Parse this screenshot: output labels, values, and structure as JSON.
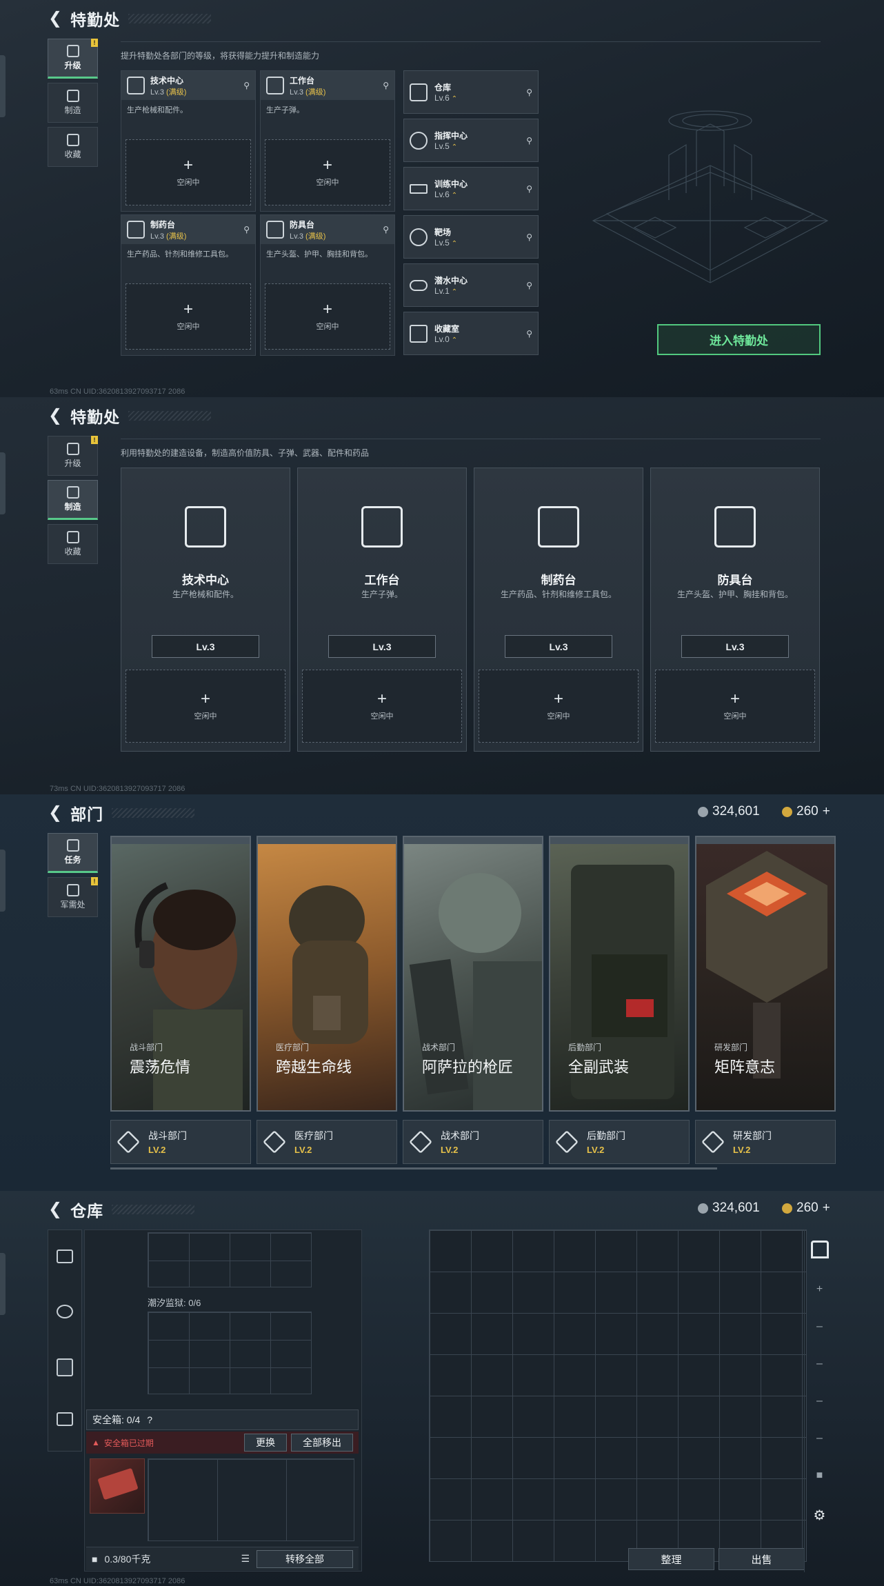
{
  "panel1": {
    "title": "特勤处",
    "description": "提升特勤处各部门的等级，将获得能力提升和制造能力",
    "tabs": [
      {
        "label": "升级",
        "badge": "!"
      },
      {
        "label": "制造"
      },
      {
        "label": "收藏"
      }
    ],
    "workshops": [
      {
        "name": "技术中心",
        "level": "Lv.3",
        "maxed": "(满级)",
        "desc": "生产枪械和配件。",
        "slot": "空闲中"
      },
      {
        "name": "工作台",
        "level": "Lv.3",
        "maxed": "(满级)",
        "desc": "生产子弹。",
        "slot": "空闲中"
      },
      {
        "name": "制药台",
        "level": "Lv.3",
        "maxed": "(满级)",
        "desc": "生产药品、针剂和维修工具包。",
        "slot": "空闲中"
      },
      {
        "name": "防具台",
        "level": "Lv.3",
        "maxed": "(满级)",
        "desc": "生产头盔、护甲、胸挂和背包。",
        "slot": "空闲中"
      }
    ],
    "rooms": [
      {
        "name": "仓库",
        "level": "Lv.6"
      },
      {
        "name": "指挥中心",
        "level": "Lv.5"
      },
      {
        "name": "训练中心",
        "level": "Lv.6"
      },
      {
        "name": "靶场",
        "level": "Lv.5"
      },
      {
        "name": "潜水中心",
        "level": "Lv.1"
      },
      {
        "name": "收藏室",
        "level": "Lv.0"
      }
    ],
    "enter_button": "进入特勤处",
    "status": "63ms   CN UID:3620813927093717 2086"
  },
  "panel2": {
    "title": "特勤处",
    "description": "利用特勤处的建造设备，制造高价值防具、子弹、武器、配件和药品",
    "tabs": [
      {
        "label": "升级",
        "badge": "!"
      },
      {
        "label": "制造"
      },
      {
        "label": "收藏"
      }
    ],
    "cards": [
      {
        "name": "技术中心",
        "desc": "生产枪械和配件。",
        "level": "Lv.3",
        "slot": "空闲中"
      },
      {
        "name": "工作台",
        "desc": "生产子弹。",
        "level": "Lv.3",
        "slot": "空闲中"
      },
      {
        "name": "制药台",
        "desc": "生产药品、针剂和维修工具包。",
        "level": "Lv.3",
        "slot": "空闲中"
      },
      {
        "name": "防具台",
        "desc": "生产头盔、护甲、胸挂和背包。",
        "level": "Lv.3",
        "slot": "空闲中"
      }
    ],
    "status": "73ms   CN UID:3620813927093717 2086"
  },
  "panel3": {
    "title": "部门",
    "currency": {
      "silver": "324,601",
      "gold": "260"
    },
    "tabs": [
      {
        "label": "任务"
      },
      {
        "label": "军需处",
        "badge": "!"
      }
    ],
    "departments": [
      {
        "category": "战斗部门",
        "name": "震荡危情",
        "dept": "战斗部门",
        "level": "LV.2"
      },
      {
        "category": "医疗部门",
        "name": "跨越生命线",
        "dept": "医疗部门",
        "level": "LV.2"
      },
      {
        "category": "战术部门",
        "name": "阿萨拉的枪匠",
        "dept": "战术部门",
        "level": "LV.2"
      },
      {
        "category": "后勤部门",
        "name": "全副武装",
        "dept": "后勤部门",
        "level": "LV.2"
      },
      {
        "category": "研发部门",
        "name": "矩阵意志",
        "dept": "研发部门",
        "level": "LV.2"
      }
    ]
  },
  "panel4": {
    "title": "仓库",
    "currency": {
      "silver": "324,601",
      "gold": "260"
    },
    "tidal_prison": "潮汐监狱: 0/6",
    "safe_box": "安全箱: 0/4",
    "safe_box_help": "?",
    "warning": "安全箱已过期",
    "replace_button": "更换",
    "remove_all_button": "全部移出",
    "weight": "0.3/80千克",
    "transfer_all_button": "转移全部",
    "organize_button": "整理",
    "sell_button": "出售",
    "status": "63ms   CN UID:3620813927093717 2086"
  }
}
